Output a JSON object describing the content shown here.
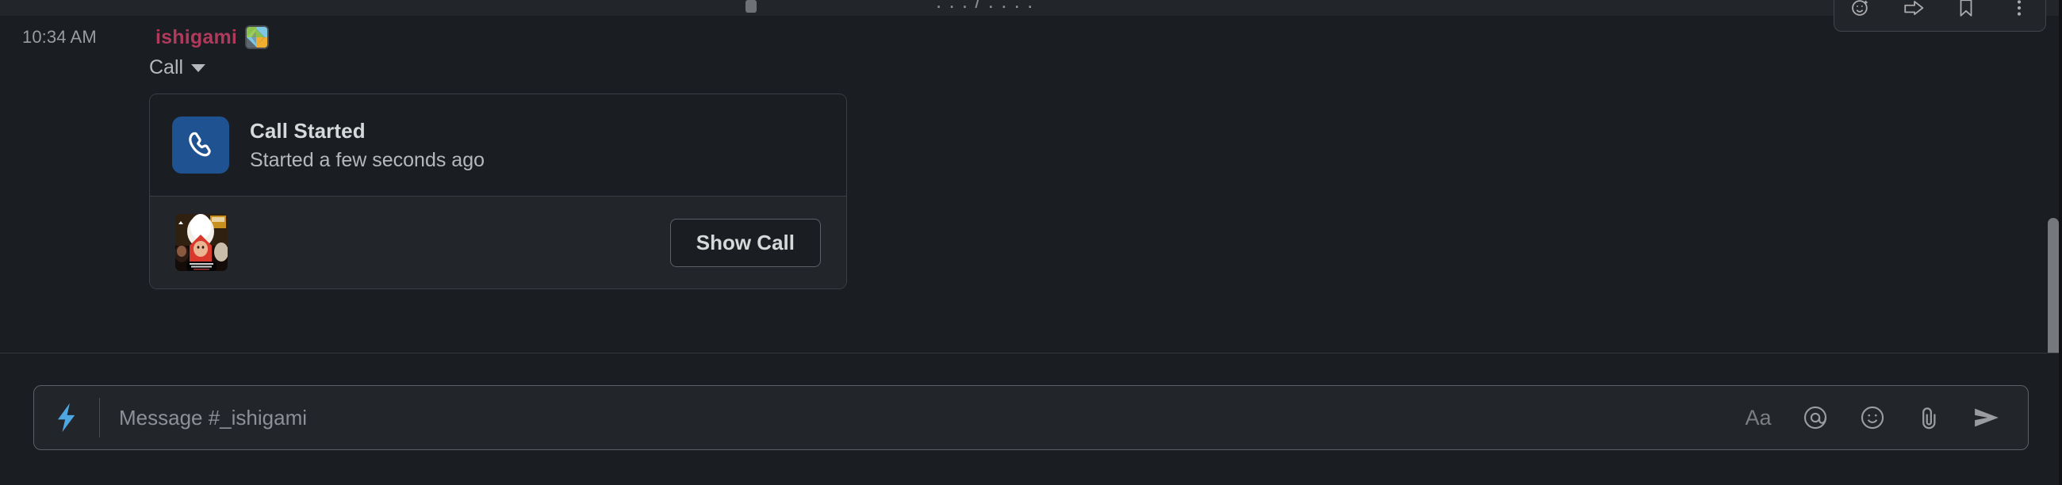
{
  "app": "slack",
  "colors": {
    "app_bg": "#1a1d21",
    "panel_bg": "#222529",
    "border": "#3a3f45",
    "username": "#b13a5c",
    "call_icon_blue": "#1f5290",
    "bolt_blue": "#4ea7e0",
    "text_primary": "#d1d2d3",
    "text_secondary": "#b6b8bb",
    "text_muted": "#9a9c9f"
  },
  "hover_toolbar": {
    "actions": [
      {
        "name": "add-reaction-icon",
        "label": "Add reaction"
      },
      {
        "name": "forward-message-icon",
        "label": "Forward message"
      },
      {
        "name": "save-message-icon",
        "label": "Save for later"
      },
      {
        "name": "more-actions-icon",
        "label": "More actions"
      }
    ]
  },
  "message": {
    "timestamp": "10:34 AM",
    "author": "ishigami",
    "author_badge_name": "custom-status-badge",
    "subtext": "Call",
    "subtext_caret_name": "chevron-down-icon"
  },
  "call_card": {
    "icon_name": "phone-icon",
    "title": "Call Started",
    "subtitle": "Started a few seconds ago",
    "thumbnail_name": "participant-thumbnail",
    "button_label": "Show Call"
  },
  "composer": {
    "shortcuts_icon_name": "lightning-bolt-icon",
    "placeholder": "Message #_ishigami",
    "value": "",
    "actions": [
      {
        "name": "formatting-toggle",
        "label": "Aa"
      },
      {
        "name": "mention-icon",
        "label": "@"
      },
      {
        "name": "emoji-icon",
        "label": "Emoji"
      },
      {
        "name": "attachment-icon",
        "label": "Attach"
      },
      {
        "name": "send-icon",
        "label": "Send"
      }
    ]
  },
  "scrollbar": {
    "name": "message-list-scrollbar",
    "orientation": "vertical"
  }
}
